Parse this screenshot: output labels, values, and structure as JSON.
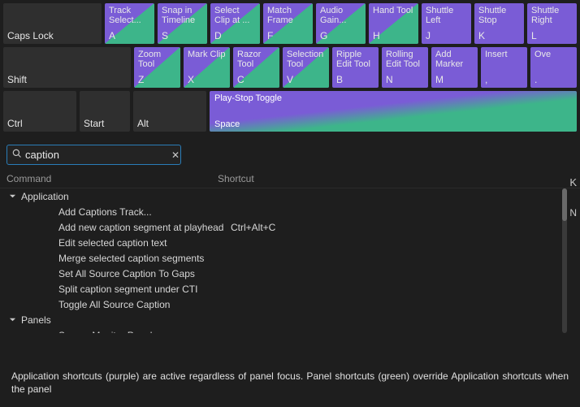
{
  "keyboard": {
    "row1": {
      "caps": "Caps Lock",
      "keys": [
        {
          "top": "Track Select...",
          "bottom": "A",
          "style": "split"
        },
        {
          "top": "Snap in Timeline",
          "bottom": "S",
          "style": "split"
        },
        {
          "top": "Select Clip at ...",
          "bottom": "D",
          "style": "split"
        },
        {
          "top": "Match Frame",
          "bottom": "F",
          "style": "split"
        },
        {
          "top": "Audio Gain...",
          "bottom": "G",
          "style": "split"
        },
        {
          "top": "Hand Tool",
          "bottom": "H",
          "style": "split"
        },
        {
          "top": "Shuttle Left",
          "bottom": "J",
          "style": "purple"
        },
        {
          "top": "Shuttle Stop",
          "bottom": "K",
          "style": "purple"
        },
        {
          "top": "Shuttle Right",
          "bottom": "L",
          "style": "purple"
        }
      ]
    },
    "row2": {
      "shift": "Shift",
      "keys": [
        {
          "top": "Zoom Tool",
          "bottom": "Z",
          "style": "split"
        },
        {
          "top": "Mark Clip",
          "bottom": "X",
          "style": "split"
        },
        {
          "top": "Razor Tool",
          "bottom": "C",
          "style": "split"
        },
        {
          "top": "Selection Tool",
          "bottom": "V",
          "style": "split"
        },
        {
          "top": "Ripple Edit Tool",
          "bottom": "B",
          "style": "purple"
        },
        {
          "top": "Rolling Edit Tool",
          "bottom": "N",
          "style": "purple"
        },
        {
          "top": "Add Marker",
          "bottom": "M",
          "style": "purple"
        },
        {
          "top": "Insert",
          "bottom": ",",
          "style": "purple"
        },
        {
          "top": "Ove",
          "bottom": ".",
          "style": "purple"
        }
      ]
    },
    "row3": {
      "ctrl": "Ctrl",
      "start": "Start",
      "alt": "Alt",
      "space_top": "Play-Stop Toggle",
      "space_bottom": "Space"
    }
  },
  "search": {
    "value": "caption",
    "right_cut": "K"
  },
  "table": {
    "headers": {
      "command": "Command",
      "shortcut": "Shortcut"
    },
    "right_col_cut": "N",
    "groups": [
      {
        "name": "Application",
        "expanded": true,
        "items": [
          {
            "cmd": "Add Captions Track...",
            "sc": ""
          },
          {
            "cmd": "Add new caption segment at playhead",
            "sc": "Ctrl+Alt+C"
          },
          {
            "cmd": "Edit selected caption text",
            "sc": ""
          },
          {
            "cmd": "Merge selected caption segments",
            "sc": ""
          },
          {
            "cmd": "Set All Source Caption To Gaps",
            "sc": ""
          },
          {
            "cmd": "Split caption segment under CTI",
            "sc": ""
          },
          {
            "cmd": "Toggle All Source Caption",
            "sc": ""
          }
        ]
      },
      {
        "name": "Panels",
        "expanded": true,
        "items": [
          {
            "cmd": "Source Monitor Panel",
            "sc": ""
          }
        ]
      }
    ]
  },
  "footer": "Application shortcuts (purple) are active regardless of panel focus. Panel shortcuts (green) override Application shortcuts when the panel"
}
